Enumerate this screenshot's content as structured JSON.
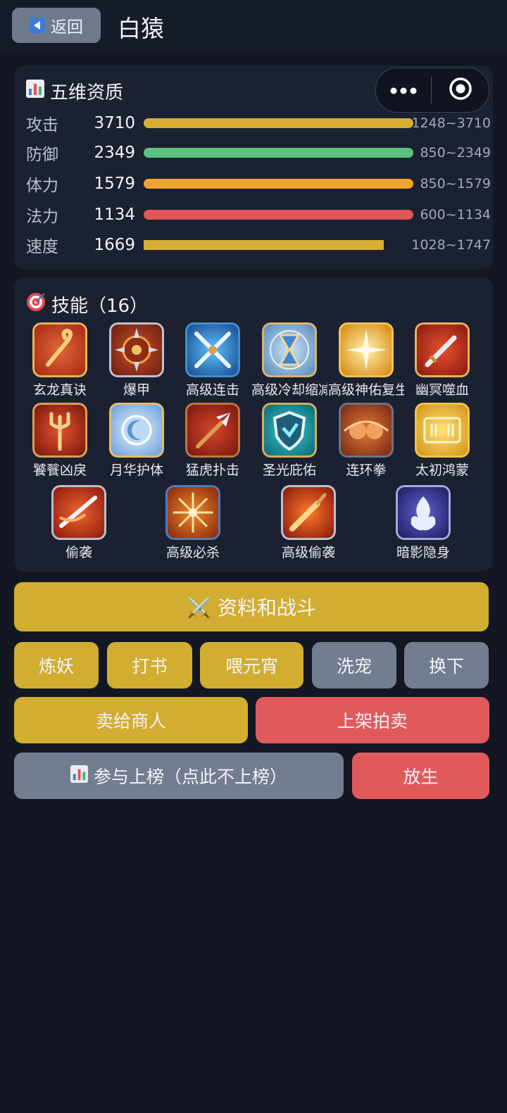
{
  "header": {
    "back_label": "返回",
    "title": "白猿"
  },
  "stats": {
    "title": "五维资质",
    "title_icon": "bar-chart-icon",
    "rows": [
      {
        "label": "攻击",
        "value": "3710",
        "range": "1248~3710",
        "fill": 1.0,
        "color": "#d5ae33"
      },
      {
        "label": "防御",
        "value": "2349",
        "range": "850~2349",
        "fill": 1.0,
        "color": "#5bc27f"
      },
      {
        "label": "体力",
        "value": "1579",
        "range": "850~1579",
        "fill": 1.0,
        "color": "#f0a22e"
      },
      {
        "label": "法力",
        "value": "1134",
        "range": "600~1134",
        "fill": 1.0,
        "color": "#df5558"
      },
      {
        "label": "速度",
        "value": "1669",
        "range": "1028~1747",
        "fill": 0.89,
        "color": "#d5ae33"
      }
    ]
  },
  "skills": {
    "title": "技能（16）",
    "title_icon": "target-icon",
    "items": [
      {
        "name": "玄龙真诀",
        "icon": "golden-staff-icon"
      },
      {
        "name": "爆甲",
        "icon": "spiked-armor-icon"
      },
      {
        "name": "高级连击",
        "icon": "crossed-swords-icon"
      },
      {
        "name": "高级冷却缩减",
        "icon": "hourglass-icon"
      },
      {
        "name": "高级神佑复生",
        "icon": "holy-light-icon"
      },
      {
        "name": "幽冥噬血",
        "icon": "bloody-sword-icon"
      },
      {
        "name": "饕餮凶戾",
        "icon": "trident-icon"
      },
      {
        "name": "月华护体",
        "icon": "moon-shield-icon"
      },
      {
        "name": "猛虎扑击",
        "icon": "spear-icon"
      },
      {
        "name": "圣光庇佑",
        "icon": "shield-icon"
      },
      {
        "name": "连环拳",
        "icon": "fists-icon"
      },
      {
        "name": "太初鸿蒙",
        "icon": "fortune-icon"
      },
      {
        "name": "偷袭",
        "icon": "swift-blade-icon"
      },
      {
        "name": "高级必杀",
        "icon": "burst-icon"
      },
      {
        "name": "高级偷袭",
        "icon": "flaming-dagger-icon"
      },
      {
        "name": "暗影隐身",
        "icon": "shadow-flame-icon"
      }
    ]
  },
  "actions": {
    "info_battle": "⚔️ 资料和战斗",
    "refine": "炼妖",
    "skill_book": "打书",
    "feed": "喂元宵",
    "wash": "洗宠",
    "swap": "换下",
    "sell": "卖给商人",
    "auction": "上架拍卖",
    "ranking": "参与上榜（点此不上榜）",
    "ranking_icon": "bar-chart-icon",
    "release": "放生"
  },
  "colors": {
    "gold": "#d1ad31",
    "gray": "#727d90",
    "red": "#e05a5c",
    "background": "#121722",
    "card": "#1b2131"
  }
}
